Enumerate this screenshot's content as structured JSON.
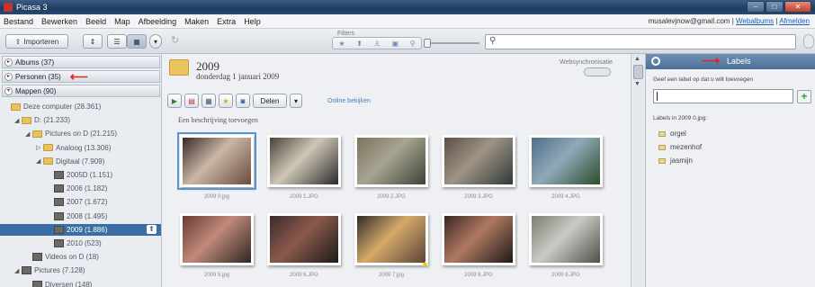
{
  "window": {
    "title": "Picasa 3"
  },
  "menu": [
    "Bestand",
    "Bewerken",
    "Beeld",
    "Map",
    "Afbeelding",
    "Maken",
    "Extra",
    "Help"
  ],
  "account": {
    "email": "musalevjnow@gmail.com",
    "sep": "|",
    "webalbums": "Webalbums",
    "signout": "Afmelden"
  },
  "toolbar": {
    "import_label": "Importeren",
    "filters_label": "Filters",
    "search_placeholder": ""
  },
  "left": {
    "sections": [
      {
        "label": "Albums (37)"
      },
      {
        "label": "Personen (35)"
      },
      {
        "label": "Mappen (90)"
      }
    ],
    "tree": [
      {
        "label": "Deze computer (28.361)",
        "indent": 0,
        "arrow": "",
        "type": "folder"
      },
      {
        "label": "D: (21.233)",
        "indent": 1,
        "arrow": "◢",
        "type": "folder"
      },
      {
        "label": "Pictures on D (21.215)",
        "indent": 2,
        "arrow": "◢",
        "type": "folder"
      },
      {
        "label": "Analoog (13.306)",
        "indent": 3,
        "arrow": "▷",
        "type": "folder"
      },
      {
        "label": "Digitaal (7.909)",
        "indent": 3,
        "arrow": "◢",
        "type": "folder"
      },
      {
        "label": "2005D (1.151)",
        "indent": 4,
        "arrow": "",
        "type": "thumb"
      },
      {
        "label": "2006 (1.182)",
        "indent": 4,
        "arrow": "",
        "type": "thumb"
      },
      {
        "label": "2007 (1.672)",
        "indent": 4,
        "arrow": "",
        "type": "thumb"
      },
      {
        "label": "2008 (1.495)",
        "indent": 4,
        "arrow": "",
        "type": "thumb"
      },
      {
        "label": "2009 (1.886)",
        "indent": 4,
        "arrow": "",
        "type": "thumb",
        "selected": true
      },
      {
        "label": "2010 (523)",
        "indent": 4,
        "arrow": "",
        "type": "thumb"
      },
      {
        "label": "Videos on D (18)",
        "indent": 2,
        "arrow": "",
        "type": "thumb"
      },
      {
        "label": "Pictures (7.128)",
        "indent": 1,
        "arrow": "◢",
        "type": "thumb"
      },
      {
        "label": "Diversen (148)",
        "indent": 2,
        "arrow": "",
        "type": "thumb"
      }
    ]
  },
  "main": {
    "year": "2009",
    "date": "donderdag 1 januari 2009",
    "webalbum_label": "Websynchronisatie",
    "share_label": "Delen",
    "share_online_label": "Online bekijken",
    "description_placeholder": "Een beschrijving toevoegen",
    "photos": [
      {
        "caption": "2009 0.jpg",
        "colors": [
          "#3b2a26",
          "#c9b6a6",
          "#6d4b3e"
        ],
        "selected": true
      },
      {
        "caption": "2009 1.JPG",
        "colors": [
          "#4a4238",
          "#cfc7b6",
          "#2b2a2c"
        ]
      },
      {
        "caption": "2009 2.JPG",
        "colors": [
          "#7a7460",
          "#a7a491",
          "#3d4336"
        ]
      },
      {
        "caption": "2009 3.JPG",
        "colors": [
          "#5e4f45",
          "#9e9385",
          "#2f3a3a"
        ]
      },
      {
        "caption": "2009 4.JPG",
        "colors": [
          "#4f6f88",
          "#8fa9b8",
          "#2c4d2a"
        ]
      },
      {
        "caption": "2009 5.jpg",
        "colors": [
          "#6b3a34",
          "#c08a7a",
          "#2e2622"
        ]
      },
      {
        "caption": "2009 6.JPG",
        "colors": [
          "#3a2a2e",
          "#8a5a4a",
          "#1d1a1c"
        ]
      },
      {
        "caption": "2009 7.jpg",
        "colors": [
          "#2e2a26",
          "#d6a96a",
          "#5a4436"
        ],
        "starred": true
      },
      {
        "caption": "2009 8.JPG",
        "colors": [
          "#3a2622",
          "#b07a62",
          "#1e1816"
        ]
      },
      {
        "caption": "2009 9.JPG",
        "colors": [
          "#7b7e74",
          "#c9ccc4",
          "#4d5048"
        ]
      }
    ]
  },
  "labels": {
    "title": "Labels",
    "hint": "Geef een label op dat u wilt toevoegen",
    "input_value": "",
    "subheading": "Labels in 2009 0.jpg:",
    "items": [
      "orgel",
      "mezenhof",
      "jasmijn"
    ]
  }
}
